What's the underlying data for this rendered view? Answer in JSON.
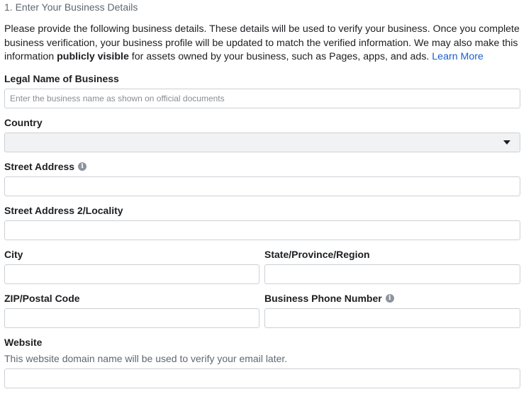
{
  "step_title": "1. Enter Your Business Details",
  "intro": {
    "part1": "Please provide the following business details. These details will be used to verify your business. Once you complete business verification, your business profile will be updated to match the verified information. We may also make this information ",
    "bold": "publicly visible",
    "part2": " for assets owned by your business, such as Pages, apps, and ads. ",
    "learn_more": "Learn More"
  },
  "legal_name": {
    "label": "Legal Name of Business",
    "placeholder": "Enter the business name as shown on official documents",
    "value": ""
  },
  "country": {
    "label": "Country",
    "selected": ""
  },
  "street_address": {
    "label": "Street Address",
    "value": ""
  },
  "street_address_2": {
    "label": "Street Address 2/Locality",
    "value": ""
  },
  "city": {
    "label": "City",
    "value": ""
  },
  "state": {
    "label": "State/Province/Region",
    "value": ""
  },
  "zip": {
    "label": "ZIP/Postal Code",
    "value": ""
  },
  "phone": {
    "label": "Business Phone Number",
    "value": ""
  },
  "website": {
    "label": "Website",
    "helper": "This website domain name will be used to verify your email later.",
    "value": ""
  },
  "icons": {
    "info": "info-icon",
    "dropdown": "chevron-down-icon"
  }
}
